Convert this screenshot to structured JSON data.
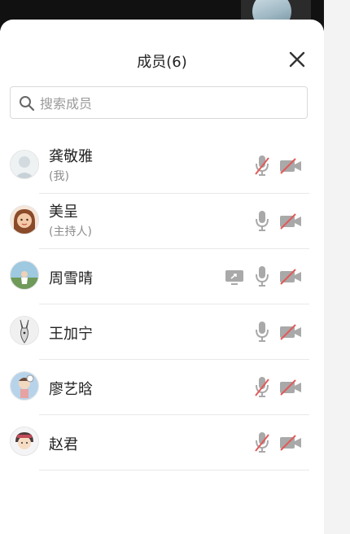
{
  "header": {
    "title": "成员(6)"
  },
  "search": {
    "placeholder": "搜索成员",
    "value": ""
  },
  "members": [
    {
      "name": "龚敬雅",
      "role": "(我)",
      "mic_muted": true,
      "camera_off": true,
      "screen_share": false
    },
    {
      "name": "美呈",
      "role": "(主持人)",
      "mic_muted": false,
      "camera_off": true,
      "screen_share": false
    },
    {
      "name": "周雪晴",
      "role": "",
      "mic_muted": false,
      "camera_off": true,
      "screen_share": true
    },
    {
      "name": "王加宁",
      "role": "",
      "mic_muted": false,
      "camera_off": true,
      "screen_share": false
    },
    {
      "name": "廖艺晗",
      "role": "",
      "mic_muted": true,
      "camera_off": true,
      "screen_share": false
    },
    {
      "name": "赵君",
      "role": "",
      "mic_muted": true,
      "camera_off": true,
      "screen_share": false
    }
  ],
  "icons": {
    "close": "close-icon",
    "search": "search-icon",
    "mic": "microphone-icon",
    "mic_muted": "microphone-muted-icon",
    "camera_off": "camera-off-icon",
    "screen_share": "screen-share-icon"
  },
  "colors": {
    "muted_red": "#e25a5a",
    "icon_gray": "#a9a9a9"
  }
}
